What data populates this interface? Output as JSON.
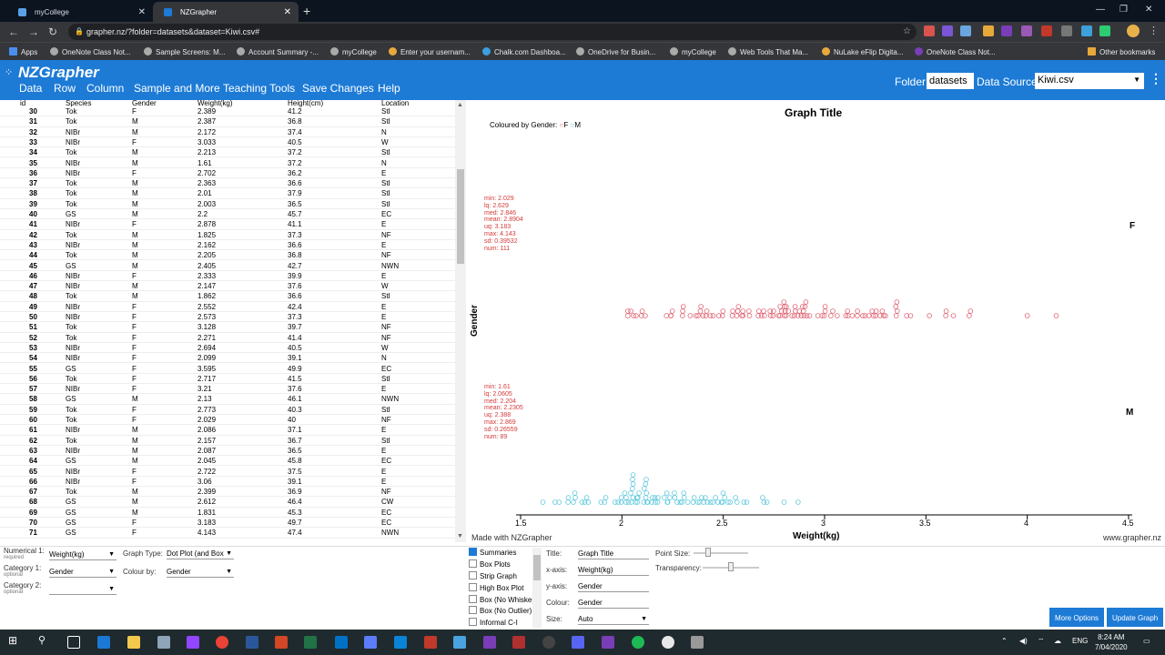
{
  "browser": {
    "tabs": [
      {
        "title": "myCollege",
        "active": false
      },
      {
        "title": "NZGrapher",
        "active": true
      }
    ],
    "url": "grapher.nz/?folder=datasets&dataset=Kiwi.csv#",
    "bookmarks": [
      "Apps",
      "OneNote Class Not...",
      "Sample Screens: M...",
      "Account Summary -...",
      "myCollege",
      "Enter your usernam...",
      "Chalk.com Dashboa...",
      "OneDrive for Busin...",
      "myCollege",
      "Web Tools That Ma...",
      "NuLake eFlip Digita...",
      "OneNote Class Not...",
      "Other bookmarks"
    ]
  },
  "app": {
    "logo": "NZGrapher",
    "menu": [
      "Data",
      "Row",
      "Column",
      "Sample and More",
      "Teaching Tools",
      "Save Changes",
      "Help"
    ],
    "folder_label": "Folder:",
    "folder_value": "datasets",
    "datasource_label": "Data Source:",
    "datasource_value": "Kiwi.csv"
  },
  "table": {
    "headers": [
      "id",
      "Species",
      "Gender",
      "Weight(kg)",
      "Height(cm)",
      "Location"
    ],
    "rows": [
      [
        "30",
        "Tok",
        "F",
        "2.389",
        "41.2",
        "StI"
      ],
      [
        "31",
        "Tok",
        "M",
        "2.387",
        "36.8",
        "StI"
      ],
      [
        "32",
        "NIBr",
        "M",
        "2.172",
        "37.4",
        "N"
      ],
      [
        "33",
        "NIBr",
        "F",
        "3.033",
        "40.5",
        "W"
      ],
      [
        "34",
        "Tok",
        "M",
        "2.213",
        "37.2",
        "StI"
      ],
      [
        "35",
        "NIBr",
        "M",
        "1.61",
        "37.2",
        "N"
      ],
      [
        "36",
        "NIBr",
        "F",
        "2.702",
        "36.2",
        "E"
      ],
      [
        "37",
        "Tok",
        "M",
        "2.363",
        "36.6",
        "StI"
      ],
      [
        "38",
        "Tok",
        "M",
        "2.01",
        "37.9",
        "StI"
      ],
      [
        "39",
        "Tok",
        "M",
        "2.003",
        "36.5",
        "StI"
      ],
      [
        "40",
        "GS",
        "M",
        "2.2",
        "45.7",
        "EC"
      ],
      [
        "41",
        "NIBr",
        "F",
        "2.878",
        "41.1",
        "E"
      ],
      [
        "42",
        "Tok",
        "M",
        "1.825",
        "37.3",
        "NF"
      ],
      [
        "43",
        "NIBr",
        "M",
        "2.162",
        "36.6",
        "E"
      ],
      [
        "44",
        "Tok",
        "M",
        "2.205",
        "36.8",
        "NF"
      ],
      [
        "45",
        "GS",
        "M",
        "2.405",
        "42.7",
        "NWN"
      ],
      [
        "46",
        "NIBr",
        "F",
        "2.333",
        "39.9",
        "E"
      ],
      [
        "47",
        "NIBr",
        "M",
        "2.147",
        "37.6",
        "W"
      ],
      [
        "48",
        "Tok",
        "M",
        "1.862",
        "36.6",
        "StI"
      ],
      [
        "49",
        "NIBr",
        "F",
        "2.552",
        "42.4",
        "E"
      ],
      [
        "50",
        "NIBr",
        "F",
        "2.573",
        "37.3",
        "E"
      ],
      [
        "51",
        "Tok",
        "F",
        "3.128",
        "39.7",
        "NF"
      ],
      [
        "52",
        "Tok",
        "F",
        "2.271",
        "41.4",
        "NF"
      ],
      [
        "53",
        "NIBr",
        "F",
        "2.694",
        "40.5",
        "W"
      ],
      [
        "54",
        "NIBr",
        "F",
        "2.099",
        "39.1",
        "N"
      ],
      [
        "55",
        "GS",
        "F",
        "3.595",
        "49.9",
        "EC"
      ],
      [
        "56",
        "Tok",
        "F",
        "2.717",
        "41.5",
        "StI"
      ],
      [
        "57",
        "NIBr",
        "F",
        "3.21",
        "37.6",
        "E"
      ],
      [
        "58",
        "GS",
        "M",
        "2.13",
        "46.1",
        "NWN"
      ],
      [
        "59",
        "Tok",
        "F",
        "2.773",
        "40.3",
        "StI"
      ],
      [
        "60",
        "Tok",
        "F",
        "2.029",
        "40",
        "NF"
      ],
      [
        "61",
        "NIBr",
        "M",
        "2.086",
        "37.1",
        "E"
      ],
      [
        "62",
        "Tok",
        "M",
        "2.157",
        "36.7",
        "StI"
      ],
      [
        "63",
        "NIBr",
        "M",
        "2.087",
        "36.5",
        "E"
      ],
      [
        "64",
        "GS",
        "M",
        "2.045",
        "45.8",
        "EC"
      ],
      [
        "65",
        "NIBr",
        "F",
        "2.722",
        "37.5",
        "E"
      ],
      [
        "66",
        "NIBr",
        "F",
        "3.06",
        "39.1",
        "E"
      ],
      [
        "67",
        "Tok",
        "M",
        "2.399",
        "36.9",
        "NF"
      ],
      [
        "68",
        "GS",
        "M",
        "2.612",
        "46.4",
        "CW"
      ],
      [
        "69",
        "GS",
        "M",
        "1.831",
        "45.3",
        "EC"
      ],
      [
        "70",
        "GS",
        "F",
        "3.183",
        "49.7",
        "EC"
      ],
      [
        "71",
        "GS",
        "F",
        "4.143",
        "47.4",
        "NWN"
      ]
    ]
  },
  "graph": {
    "title": "Graph Title",
    "coloured_by": "Coloured by Gender:",
    "legend": [
      {
        "label": "F",
        "color": "#e06070"
      },
      {
        "label": "M",
        "color": "#5bc8dc"
      }
    ],
    "ylabel": "Gender",
    "xlabel": "Weight(kg)",
    "made_with": "Made with NZGrapher",
    "site": "www.grapher.nz",
    "ticks": [
      "1.5",
      "2",
      "2.5",
      "3",
      "3.5",
      "4",
      "4.5"
    ],
    "groups": [
      {
        "label": "F",
        "stats": "min: 2.029\nlq: 2.629\nmed: 2.846\nmean: 2.8904\nuq: 3.183\nmax: 4.143\nsd: 0.39532\nnum: 111"
      },
      {
        "label": "M",
        "stats": "min: 1.61\nlq: 2.0605\nmed: 2.204\nmean: 2.2305\nuq: 2.388\nmax: 2.869\nsd: 0.26559\nnum: 89"
      }
    ]
  },
  "controls": {
    "numerical1_label": "Numerical 1:",
    "numerical1_note": "required",
    "numerical1_value": "Weight(kg)",
    "category1_label": "Category 1:",
    "category1_note": "optional",
    "category1_value": "Gender",
    "category2_label": "Category 2:",
    "category2_note": "optional",
    "category2_value": "",
    "graph_type_label": "Graph Type:",
    "graph_type_value": "Dot Plot (and Box",
    "colour_by_label": "Colour by:",
    "colour_by_value": "Gender",
    "checkboxes": [
      {
        "label": "Summaries",
        "checked": true
      },
      {
        "label": "Box Plots",
        "checked": false
      },
      {
        "label": "Strip Graph",
        "checked": false
      },
      {
        "label": "High Box Plot",
        "checked": false
      },
      {
        "label": "Box (No Whisker)",
        "checked": false
      },
      {
        "label": "Box (No Outlier)",
        "checked": false
      },
      {
        "label": "Informal C-I",
        "checked": false
      }
    ],
    "title_label": "Title:",
    "title_value": "Graph Title",
    "xaxis_label": "x-axis:",
    "xaxis_value": "Weight(kg)",
    "yaxis_label": "y-axis:",
    "yaxis_value": "Gender",
    "colour_label": "Colour:",
    "colour_value": "Gender",
    "size_label": "Size:",
    "size_value": "Auto",
    "point_size_label": "Point Size:",
    "transparency_label": "Transparency:",
    "more_options": "More Options",
    "update_graph": "Update Graph"
  },
  "taskbar": {
    "lang": "ENG",
    "time": "8:24 AM",
    "date": "7/04/2020"
  }
}
